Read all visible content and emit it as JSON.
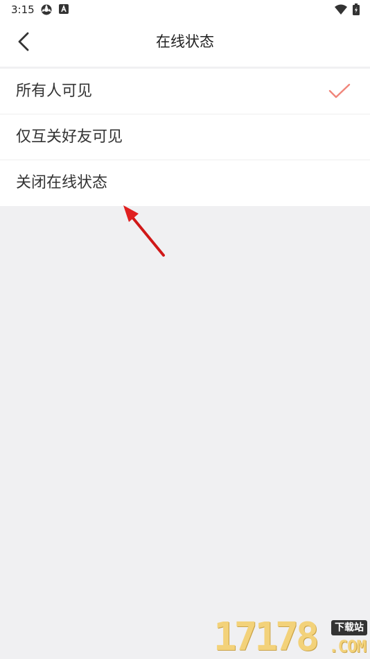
{
  "status_bar": {
    "time": "3:15",
    "icons_left": [
      "settings-gear-icon",
      "a-letter-icon"
    ],
    "icons_right": [
      "wifi-icon",
      "battery-icon"
    ]
  },
  "header": {
    "title": "在线状态",
    "back_icon": "chevron-left-icon"
  },
  "options": [
    {
      "label": "所有人可见",
      "selected": true
    },
    {
      "label": "仅互关好友可见",
      "selected": false
    },
    {
      "label": "关闭在线状态",
      "selected": false
    }
  ],
  "colors": {
    "check": "#f0857a",
    "arrow": "#e02020",
    "background": "#f0f0f2"
  },
  "watermark": {
    "digits": "17178",
    "domain": ".COM",
    "badge": "下载站"
  }
}
